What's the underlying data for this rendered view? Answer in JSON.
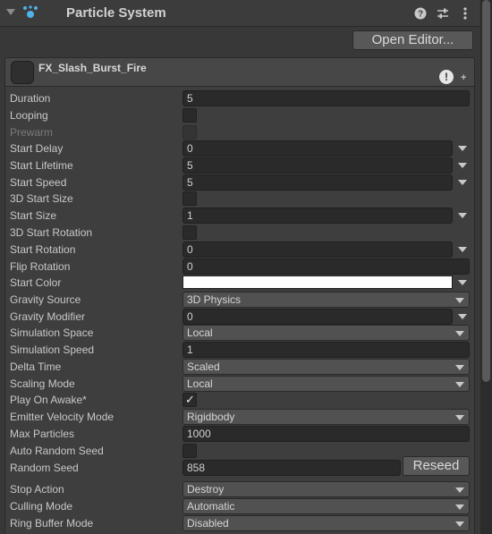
{
  "header": {
    "title": "Particle System"
  },
  "toolbar": {
    "open_editor_label": "Open Editor..."
  },
  "module": {
    "title": "FX_Slash_Burst_Fire",
    "warn_glyph": "!",
    "plus_glyph": "+"
  },
  "fields": {
    "duration": {
      "label": "Duration",
      "value": "5"
    },
    "looping": {
      "label": "Looping",
      "checked": false
    },
    "prewarm": {
      "label": "Prewarm",
      "checked": false
    },
    "start_delay": {
      "label": "Start Delay",
      "value": "0"
    },
    "start_lifetime": {
      "label": "Start Lifetime",
      "value": "5"
    },
    "start_speed": {
      "label": "Start Speed",
      "value": "5"
    },
    "start_size_3d": {
      "label": "3D Start Size",
      "checked": false
    },
    "start_size": {
      "label": "Start Size",
      "value": "1"
    },
    "start_rotation_3d": {
      "label": "3D Start Rotation",
      "checked": false
    },
    "start_rotation": {
      "label": "Start Rotation",
      "value": "0"
    },
    "flip_rotation": {
      "label": "Flip Rotation",
      "value": "0"
    },
    "start_color": {
      "label": "Start Color",
      "color": "#ffffff"
    },
    "gravity_source": {
      "label": "Gravity Source",
      "value": "3D Physics"
    },
    "gravity_modifier": {
      "label": "Gravity Modifier",
      "value": "0"
    },
    "simulation_space": {
      "label": "Simulation Space",
      "value": "Local"
    },
    "simulation_speed": {
      "label": "Simulation Speed",
      "value": "1"
    },
    "delta_time": {
      "label": "Delta Time",
      "value": "Scaled"
    },
    "scaling_mode": {
      "label": "Scaling Mode",
      "value": "Local"
    },
    "play_on_awake": {
      "label": "Play On Awake*",
      "checked": true,
      "tick": "✓"
    },
    "emitter_velocity_mode": {
      "label": "Emitter Velocity Mode",
      "value": "Rigidbody"
    },
    "max_particles": {
      "label": "Max Particles",
      "value": "1000"
    },
    "auto_random_seed": {
      "label": "Auto Random Seed",
      "checked": false
    },
    "random_seed": {
      "label": "Random Seed",
      "value": "858",
      "reseed_label": "Reseed"
    },
    "stop_action": {
      "label": "Stop Action",
      "value": "Destroy"
    },
    "culling_mode": {
      "label": "Culling Mode",
      "value": "Automatic"
    },
    "ring_buffer_mode": {
      "label": "Ring Buffer Mode",
      "value": "Disabled"
    }
  },
  "colors": {
    "accent_icon": "#4fb3e8",
    "background": "#383838"
  }
}
